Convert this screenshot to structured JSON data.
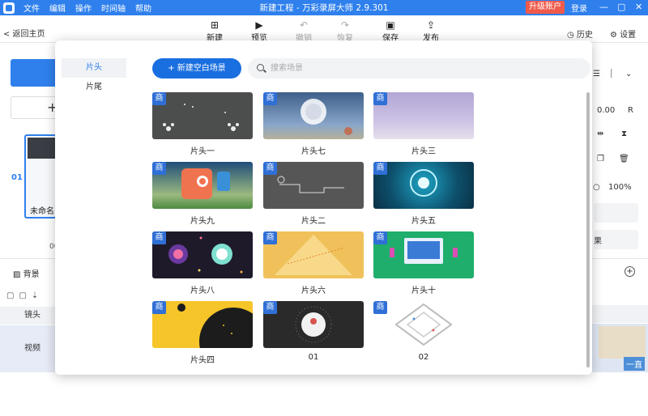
{
  "window": {
    "title": "新建工程 - 万彩录屏大师 2.9.301",
    "menu": [
      "文件",
      "编辑",
      "操作",
      "时间轴",
      "帮助"
    ],
    "upgrade_label": "升级账户",
    "login_label": "登录",
    "min_glyph": "—",
    "max_glyph": "▢",
    "close_glyph": "✕"
  },
  "toolbar": {
    "back_label": "< 返回主页",
    "new_label": "新建",
    "preview_label": "预览",
    "undo_label": "撤销",
    "redo_label": "恢复",
    "save_label": "保存",
    "publish_label": "发布",
    "history_label": "历史",
    "settings_label": "设置"
  },
  "left_panel": {
    "plus_label": "+",
    "scene_number": "01",
    "scene_name": "未命名",
    "scene_time": "00"
  },
  "right_panel": {
    "value_label": "0.00",
    "r_label": "R",
    "zoom_label": "100%",
    "crop_label": "果"
  },
  "timeline": {
    "background_label": "背景",
    "lens_label": "镜头",
    "video_label": "视频",
    "clip_tag": "一直"
  },
  "modal": {
    "categories": [
      {
        "label": "片头",
        "active": true
      },
      {
        "label": "片尾",
        "active": false
      }
    ],
    "new_blank_scene_label": "+ 新建空白场景",
    "search_placeholder": "搜索场景",
    "badge_label": "商",
    "templates": [
      {
        "name": "片头一",
        "premium": true
      },
      {
        "name": "片头七",
        "premium": true
      },
      {
        "name": "片头三",
        "premium": true
      },
      {
        "name": "片头九",
        "premium": true
      },
      {
        "name": "片头二",
        "premium": true
      },
      {
        "name": "片头五",
        "premium": true
      },
      {
        "name": "片头八",
        "premium": true
      },
      {
        "name": "片头六",
        "premium": true
      },
      {
        "name": "片头十",
        "premium": true
      },
      {
        "name": "片头四",
        "premium": true
      },
      {
        "name": "01",
        "premium": true
      },
      {
        "name": "02",
        "premium": true
      }
    ]
  },
  "colors": {
    "accent": "#2f80ed",
    "upgrade": "#f05a4a",
    "badge": "#2f6fd6"
  }
}
